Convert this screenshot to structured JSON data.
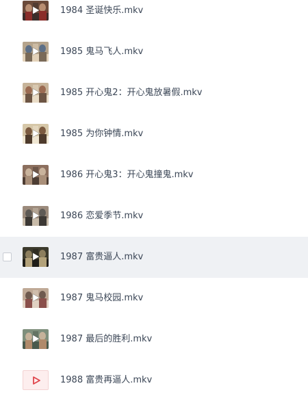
{
  "files": [
    {
      "name": "1984 圣诞快乐.mkv",
      "thumb": "video-thumbnail",
      "palette": [
        "#6b4a3a",
        "#b98e72",
        "#3a2d2a",
        "#8a2e2a"
      ]
    },
    {
      "name": "1985 鬼马飞人.mkv",
      "thumb": "video-thumbnail",
      "palette": [
        "#b5a48c",
        "#5d6f86",
        "#e3d2b9",
        "#7a6a58"
      ]
    },
    {
      "name": "1985 开心鬼2：开心鬼放暑假.mkv",
      "thumb": "video-thumbnail",
      "palette": [
        "#c7b49a",
        "#9b6b52",
        "#e9dcc6",
        "#6d5544"
      ]
    },
    {
      "name": "1985 为你钟情.mkv",
      "thumb": "video-thumbnail",
      "palette": [
        "#d6c7a8",
        "#7b5a40",
        "#efe6d2",
        "#4e3b2c"
      ]
    },
    {
      "name": "1986 开心鬼3：开心鬼撞鬼.mkv",
      "thumb": "video-thumbnail",
      "palette": [
        "#8c6f5e",
        "#c9b39c",
        "#4d3d33",
        "#a98f79"
      ]
    },
    {
      "name": "1986 恋爱季节.mkv",
      "thumb": "video-thumbnail",
      "palette": [
        "#9c8b7c",
        "#5e5a55",
        "#c8bba9",
        "#3c3834"
      ]
    },
    {
      "name": "1987 富贵逼人.mkv",
      "thumb": "video-thumbnail",
      "palette": [
        "#3c3a2c",
        "#8d7f5e",
        "#1f1d18",
        "#b3a27a"
      ]
    },
    {
      "name": "1987 鬼马校园.mkv",
      "thumb": "video-thumbnail",
      "palette": [
        "#bfa996",
        "#6f5a4f",
        "#e0d1c2",
        "#8a4f4a"
      ]
    },
    {
      "name": "1987 最后的胜利.mkv",
      "thumb": "video-thumbnail",
      "palette": [
        "#7e8f7c",
        "#c5b29a",
        "#4a5a4c",
        "#b08a6a"
      ]
    },
    {
      "name": "1988 富贵再逼人.mkv",
      "thumb": "video-file-icon",
      "palette": [
        "#fdeeee",
        "#e0454b"
      ]
    }
  ],
  "hovered_index": 6,
  "colors": {
    "row_hover": "#eff1f4",
    "text": "#3b4656",
    "play_icon_red": "#e0454b"
  },
  "icons": {
    "play": "play-icon",
    "play_outline": "play-outline-icon",
    "checkbox": "checkbox"
  }
}
